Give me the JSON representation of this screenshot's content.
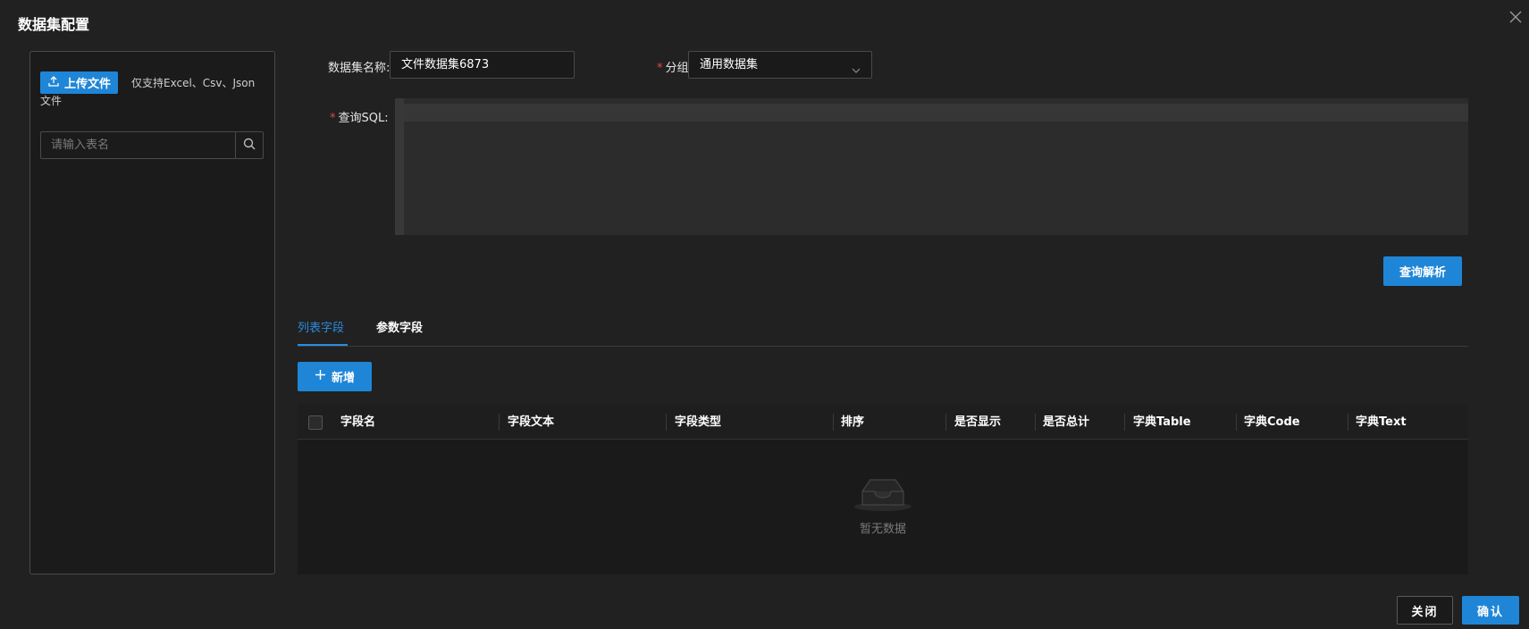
{
  "dialog": {
    "title": "数据集配置"
  },
  "left_panel": {
    "upload_label": "上传文件",
    "upload_hint": "仅支持Excel、Csv、Json文件",
    "search_placeholder": "请输入表名"
  },
  "form": {
    "name_label": "数据集名称:",
    "name_value": "文件数据集6873",
    "group_label": "分组:",
    "group_value": "通用数据集",
    "sql_label": "查询SQL:",
    "sql_value": "",
    "required_mark": "*"
  },
  "parse_button": "查询解析",
  "tabs": [
    {
      "label": "列表字段",
      "active": true
    },
    {
      "label": "参数字段",
      "active": false
    }
  ],
  "add_button": "新增",
  "table": {
    "columns": [
      "字段名",
      "字段文本",
      "字段类型",
      "排序",
      "是否显示",
      "是否总计",
      "字典Table",
      "字典Code",
      "字典Text"
    ],
    "rows": [],
    "empty_text": "暂无数据"
  },
  "footer": {
    "close_label": "关闭",
    "confirm_label": "确认"
  },
  "colors": {
    "accent": "#1f86d7",
    "background": "#212121",
    "required": "#e04a3f"
  },
  "icons": [
    "close-icon",
    "upload-icon",
    "search-icon",
    "chevron-down-icon",
    "plus-icon",
    "empty-inbox-icon"
  ]
}
